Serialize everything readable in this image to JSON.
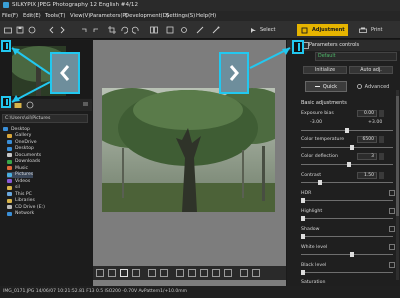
{
  "titlebar": {
    "title": "SILKYPIX JPEG Photography 12 English  #4/12"
  },
  "menu": {
    "items": [
      "File(F)",
      "Edit(E)",
      "Tools(T)",
      "View(V)",
      "Parameters(P)",
      "Development(D)",
      "Settings(S)",
      "Help(H)"
    ]
  },
  "toolbar": {
    "select_label": "Select",
    "adjustment_label": "Adjustment",
    "print_label": "Print"
  },
  "folder": {
    "path": "C:\\Users\\sil\\Pictures",
    "items": [
      "Desktop",
      "Gallery",
      "OneDrive",
      "Desktop",
      "Documents",
      "Downloads",
      "Music",
      "Pictures",
      "Videos",
      "sil",
      "This PC",
      "Libraries",
      "CD Drive (E:)",
      "Network"
    ]
  },
  "right": {
    "header": "Parameters controls",
    "default_value": "Default",
    "initialize_label": "Initialize",
    "auto_adj_label": "Auto adj.",
    "tab_quick": "Quick",
    "tab_advanced": "Advanced",
    "section_title": "Basic adjustments",
    "exposure_label": "Exposure bias",
    "exposure_value": "0.00",
    "exposure_min": "-3.00",
    "exposure_max": "+3.00",
    "colortemp_label": "Color temperature",
    "colortemp_value": "6500",
    "colordef_label": "Color deflection",
    "colordef_value": "3",
    "contrast_label": "Contrast",
    "contrast_value": "1.50",
    "hdr_label": "HDR",
    "highlight_label": "Highlight",
    "shadow_label": "Shadow",
    "whitelevel_label": "White level",
    "blacklevel_label": "Black level",
    "saturation_label": "Saturation"
  },
  "status": {
    "text": "IMG_0171.JPG 14/06/07 10:21:52.81 F13 0.5 ISO200 -0.70V AvPattern1/+10.0mm"
  },
  "colors": {
    "accent": "#e6b400",
    "highlight": "#22c8f0",
    "preset_green": "#4fb86b"
  }
}
